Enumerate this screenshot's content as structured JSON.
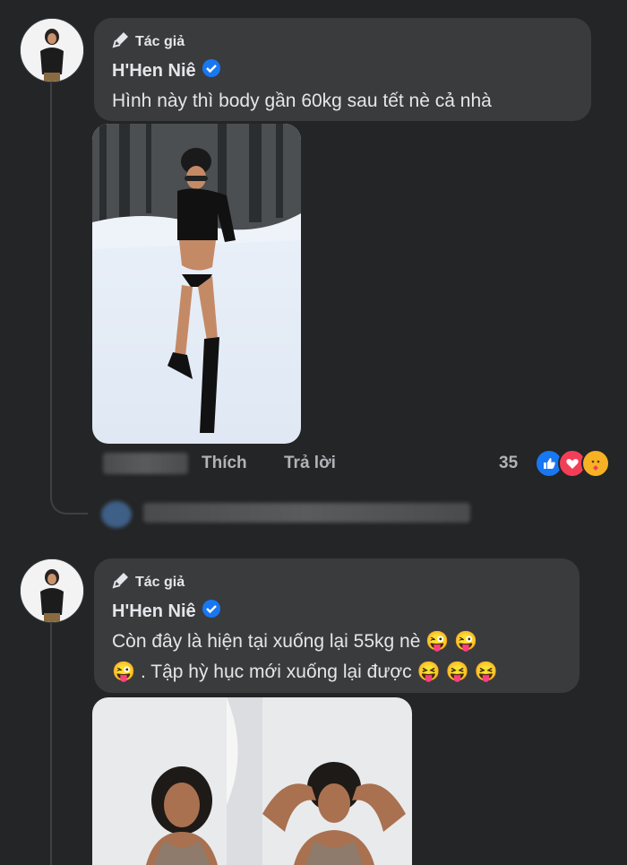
{
  "comments": [
    {
      "author_tag": "Tác giả",
      "author_name": "H'Hen Niê",
      "text": "Hình này thì body gần 60kg sau tết nè cả nhà",
      "photo_desc": "snow-outfit-photo"
    },
    {
      "author_tag": "Tác giả",
      "author_name": "H'Hen Niê",
      "text_line1": "Còn đây là hiện tại xuống lại 55kg nè 😜 😜",
      "text_line2": "😜 . Tập hỳ hục mới xuống lại được 😝 😝 😝"
    }
  ],
  "actions": {
    "like_label": "Thích",
    "reply_label": "Trả lời",
    "reaction_count": "35"
  },
  "icons": {
    "author": "microphone-icon",
    "verified": "verified-badge-icon",
    "reactions": [
      "like-reaction-icon",
      "love-reaction-icon",
      "care-reaction-icon"
    ]
  },
  "colors": {
    "background": "#242526",
    "bubble": "#3a3b3c",
    "verified_blue": "#1877f2",
    "love_red": "#f33e58"
  }
}
